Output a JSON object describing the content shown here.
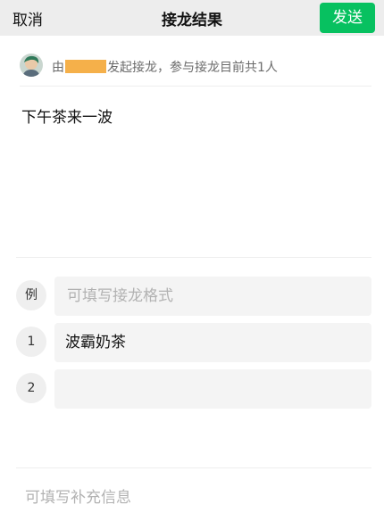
{
  "navbar": {
    "cancel_label": "取消",
    "title": "接龙结果",
    "send_label": "发送",
    "send_color": "#07c160"
  },
  "initiator": {
    "prefix": "由",
    "suffix": "发起接龙，参与接龙目前共1人",
    "avatar_icon": "user-avatar",
    "name_mask_color": "#f5b04a"
  },
  "topic": "下午茶来一波",
  "entries": [
    {
      "badge": "例",
      "value": "",
      "placeholder": "可填写接龙格式"
    },
    {
      "badge": "1",
      "value": "波霸奶茶",
      "placeholder": ""
    },
    {
      "badge": "2",
      "value": "",
      "placeholder": ""
    }
  ],
  "supplement": {
    "placeholder": "可填写补充信息"
  }
}
